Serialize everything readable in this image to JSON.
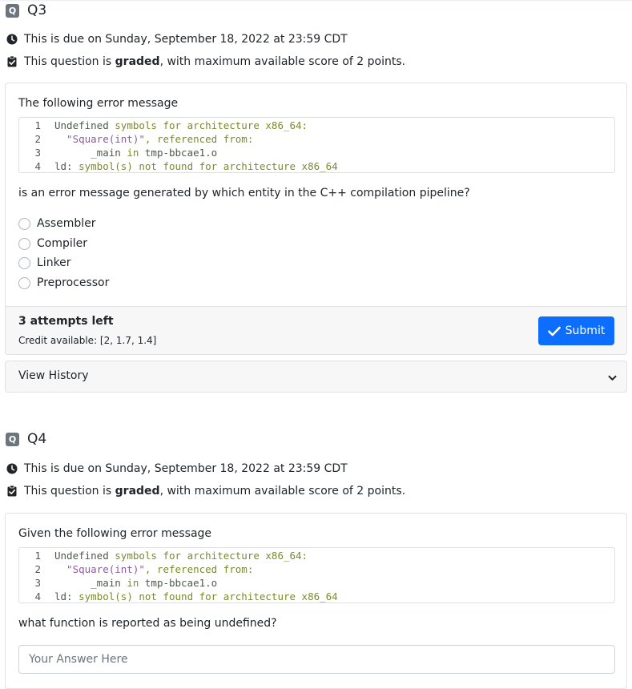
{
  "questions": [
    {
      "badge": "Q",
      "title": "Q3",
      "due_text": "This is due on Sunday, September 18, 2022 at 23:59 CDT",
      "graded_prefix": "This question is ",
      "graded_bold": "graded",
      "graded_suffix": ", with maximum available score of 2 points.",
      "prompt": "The following error message",
      "code_lines": [
        {
          "num": "1",
          "parts": [
            {
              "t": "Undefined ",
              "c": "pl"
            },
            {
              "t": "symbols for architecture x86_64:",
              "c": "kw"
            }
          ]
        },
        {
          "num": "2",
          "parts": [
            {
              "t": "  \"Square(int)\"",
              "c": "st"
            },
            {
              "t": ", referenced from:",
              "c": "kw"
            }
          ]
        },
        {
          "num": "3",
          "parts": [
            {
              "t": "      _main ",
              "c": "pl"
            },
            {
              "t": "in",
              "c": "kw"
            },
            {
              "t": " tmp-bbcae1.o",
              "c": "pl"
            }
          ]
        },
        {
          "num": "4",
          "parts": [
            {
              "t": "ld: ",
              "c": "pl"
            },
            {
              "t": "symbol(s) not found for architecture x86_64",
              "c": "kw"
            }
          ]
        }
      ],
      "question": "is an error message generated by which entity in the C++ compilation pipeline?",
      "options": [
        "Assembler",
        "Compiler",
        "Linker",
        "Preprocessor"
      ],
      "attempts": "3 attempts left",
      "credit": "Credit available: [2, 1.7, 1.4]",
      "submit_label": "Submit",
      "history_label": "View History"
    },
    {
      "badge": "Q",
      "title": "Q4",
      "due_text": "This is due on Sunday, September 18, 2022 at 23:59 CDT",
      "graded_prefix": "This question is ",
      "graded_bold": "graded",
      "graded_suffix": ", with maximum available score of 2 points.",
      "prompt": "Given the following error message",
      "code_lines": [
        {
          "num": "1",
          "parts": [
            {
              "t": "Undefined ",
              "c": "pl"
            },
            {
              "t": "symbols for architecture x86_64:",
              "c": "kw"
            }
          ]
        },
        {
          "num": "2",
          "parts": [
            {
              "t": "  \"Square(int)\"",
              "c": "st"
            },
            {
              "t": ", referenced from:",
              "c": "kw"
            }
          ]
        },
        {
          "num": "3",
          "parts": [
            {
              "t": "      _main ",
              "c": "pl"
            },
            {
              "t": "in",
              "c": "kw"
            },
            {
              "t": " tmp-bbcae1.o",
              "c": "pl"
            }
          ]
        },
        {
          "num": "4",
          "parts": [
            {
              "t": "ld: ",
              "c": "pl"
            },
            {
              "t": "symbol(s) not found for architecture x86_64",
              "c": "kw"
            }
          ]
        }
      ],
      "question": "what function is reported as being undefined?",
      "answer_placeholder": "Your Answer Here"
    }
  ],
  "icons": {
    "due": "clock-icon",
    "graded": "clipboard-check-icon",
    "submit": "checkmark-icon",
    "history": "chevron-down-icon"
  },
  "colors": {
    "primary": "#0d6efd",
    "badge": "#6c757d"
  }
}
